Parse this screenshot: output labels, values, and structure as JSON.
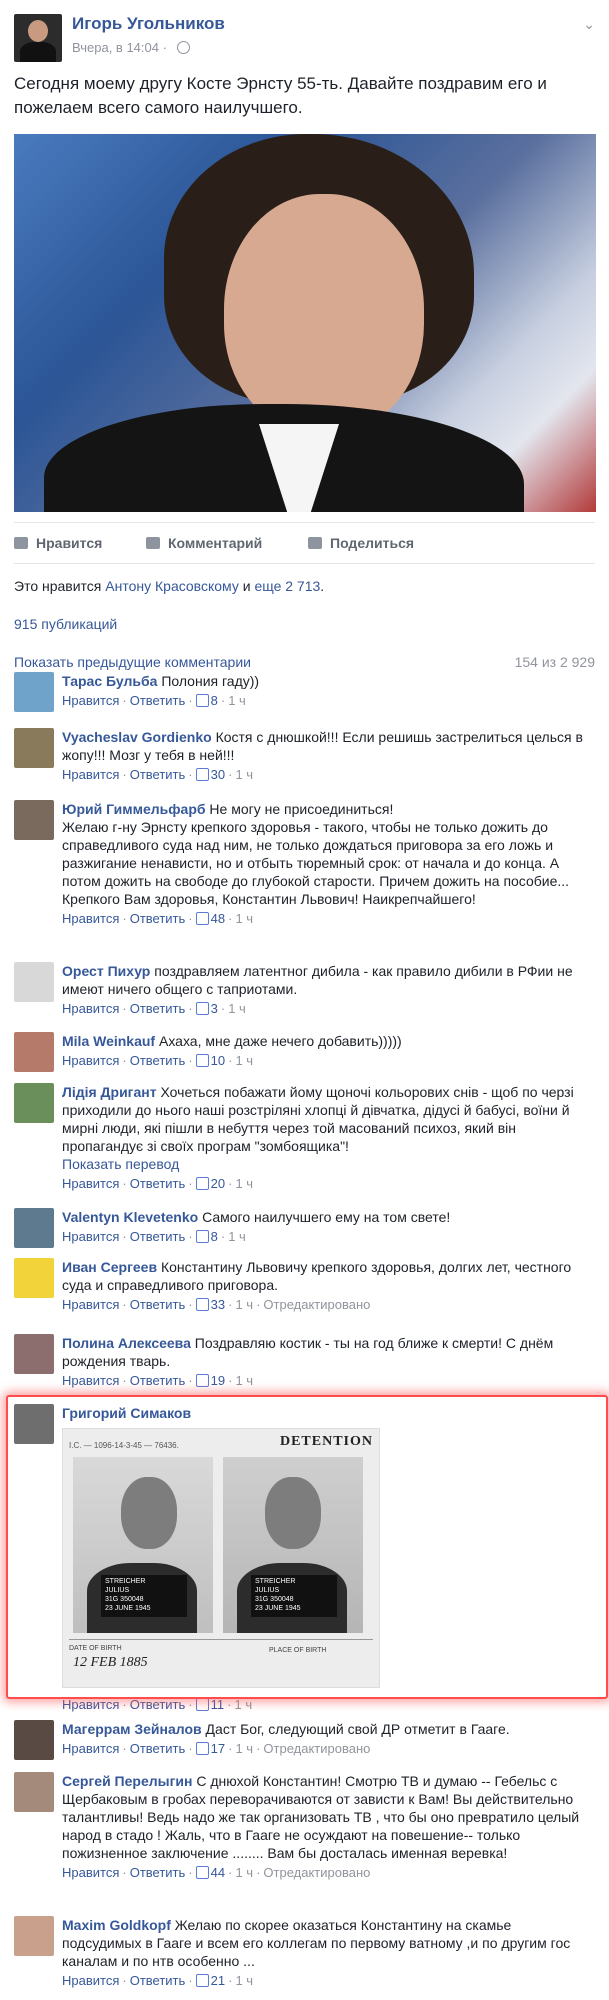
{
  "post": {
    "author": "Игорь Угольников",
    "time": "Вчера, в 14:04",
    "text": "Сегодня моему другу Косте Эрнсту 55-ть. Давайте поздравим его и пожелаем всего самого наилучшего.",
    "actions": {
      "like": "Нравится",
      "comment": "Комментарий",
      "share": "Поделиться"
    },
    "likes_prefix": "Это нравится",
    "likes_friend": "Антону Красовскому",
    "likes_and": "и",
    "likes_more": "еще 2 713",
    "likes_end": ".",
    "shares": "915 публикаций",
    "prev_comments": "Показать предыдущие комментарии",
    "comment_count": "154 из 2 929"
  },
  "comments": [
    {
      "name": "Тарас Бульба",
      "text": "Полония гаду))",
      "like": "Нравится",
      "reply": "Ответить",
      "likes": "8",
      "time": "1 ч",
      "avatar_color": "#6fa3c9"
    },
    {
      "name": "Vyacheslav Gordienko",
      "text": "Костя с днюшкой!!! Если решишь застрелиться целься в жопу!!! Мозг у тебя в ней!!!",
      "like": "Нравится",
      "reply": "Ответить",
      "likes": "30",
      "time": "1 ч",
      "avatar_color": "#8a7a5c"
    },
    {
      "name": "Юрий Гиммельфарб",
      "text": "Не могу не присоединиться!",
      "text2": "Желаю г-ну Эрнсту крепкого здоровья - такого, чтобы не только дожить до справедливого суда над ним, не только дождаться приговора за его ложь и разжигание ненависти, но и отбыть тюремный срок: от начала и до конца. А потом дожить на свободе до глубокой старости. Причем дожить на пособие...",
      "text3": "Крепкого Вам здоровья, Константин Львович! Наикрепчайшего!",
      "like": "Нравится",
      "reply": "Ответить",
      "likes": "48",
      "time": "1 ч",
      "avatar_color": "#7a6a5e"
    },
    {
      "name": "Орест Пихур",
      "text": "поздравляем латентног дибила - как правило дибили в РФии не имеют ничего общего с таприотами.",
      "like": "Нравится",
      "reply": "Ответить",
      "likes": "3",
      "time": "1 ч",
      "avatar_color": "#d8d8d8"
    },
    {
      "name": "Mila Weinkauf",
      "text": "Ахаха, мне даже нечего добавить)))))",
      "like": "Нравится",
      "reply": "Ответить",
      "likes": "10",
      "time": "1 ч",
      "avatar_color": "#b67a6a"
    },
    {
      "name": "Лідія Дригант",
      "text": "Хочеться побажати йому щоночі кольорових снів - щоб по черзі приходили до нього наші розстріляні хлопці й дівчатка, дідусі й бабусі, воїни й мирні люди, які пішли в небуття через той масований психоз, який він пропагандує зі своїх програм \"зомбоящика\"!",
      "see_translation": "Показать перевод",
      "like": "Нравится",
      "reply": "Ответить",
      "likes": "20",
      "time": "1 ч",
      "avatar_color": "#6b8f5a"
    },
    {
      "name": "Valentyn Klevetenko",
      "text": "Самого наилучшего ему на том свете!",
      "like": "Нравится",
      "reply": "Ответить",
      "likes": "8",
      "time": "1 ч",
      "avatar_color": "#5d7a8e"
    },
    {
      "name": "Иван Сергеев",
      "text": "Константину Львовичу крепкого здоровья, долгих лет, честного суда и справедливого приговора.",
      "like": "Нравится",
      "reply": "Ответить",
      "likes": "33",
      "time": "1 ч",
      "edited": "Отредактировано",
      "avatar_color": "#f2d33a"
    },
    {
      "name": "Полина Алексеева",
      "text": "Поздравляю костик - ты на год ближе к смерти! С днём рождения тварь.",
      "like": "Нравится",
      "reply": "Ответить",
      "likes": "19",
      "time": "1 ч",
      "avatar_color": "#8c6e6e"
    },
    {
      "name": "Григорий Симаков",
      "text": "",
      "like": "Нравится",
      "reply": "Ответить",
      "likes": "11",
      "time": "1 ч",
      "avatar_color": "#6e6e6e",
      "image": {
        "header": "I.C. — 1096-14-3-45 — 76436.",
        "title": "DETENTION",
        "plate_name": "STREICHER",
        "plate_first": "JULIUS",
        "plate_num": "31G 350048",
        "plate_date": "23 JUNE 1945",
        "dob_label": "DATE OF BIRTH",
        "dob": "12 FEB 1885",
        "place_label": "PLACE OF BIRTH"
      }
    },
    {
      "name": "Магеррам Зейналов",
      "text": "Даст Бог, следующий свой ДР отметит в Гааге.",
      "like": "Нравится",
      "reply": "Ответить",
      "likes": "17",
      "time": "1 ч",
      "edited": "Отредактировано",
      "avatar_color": "#5a4a44"
    },
    {
      "name": "Сергей Перелыгин",
      "text": "С днюхой Константин! Смотрю ТВ и думаю -- Гебельс с Щербаковым в гробах переворачиваются от зависти к Вам! Вы действительно талантливы! Ведь надо же так организовать ТВ , что бы оно превратило целый народ в стадо ! Жаль, что в Гааге не осуждают на повешение-- только пожизненное заключение ........ Вам бы досталась именная веревка!",
      "like": "Нравится",
      "reply": "Ответить",
      "likes": "44",
      "time": "1 ч",
      "edited": "Отредактировано",
      "avatar_color": "#a38a7a"
    },
    {
      "name": "Maxim Goldkopf",
      "text": "Желаю по скорее оказаться Константину на скамье подсудимых в Гааге и всем его коллегам по первому ватному ,и по другим гос каналам и по нтв особенно ...",
      "like": "Нравится",
      "reply": "Ответить",
      "likes": "21",
      "time": "1 ч",
      "avatar_color": "#c9a08c"
    }
  ]
}
